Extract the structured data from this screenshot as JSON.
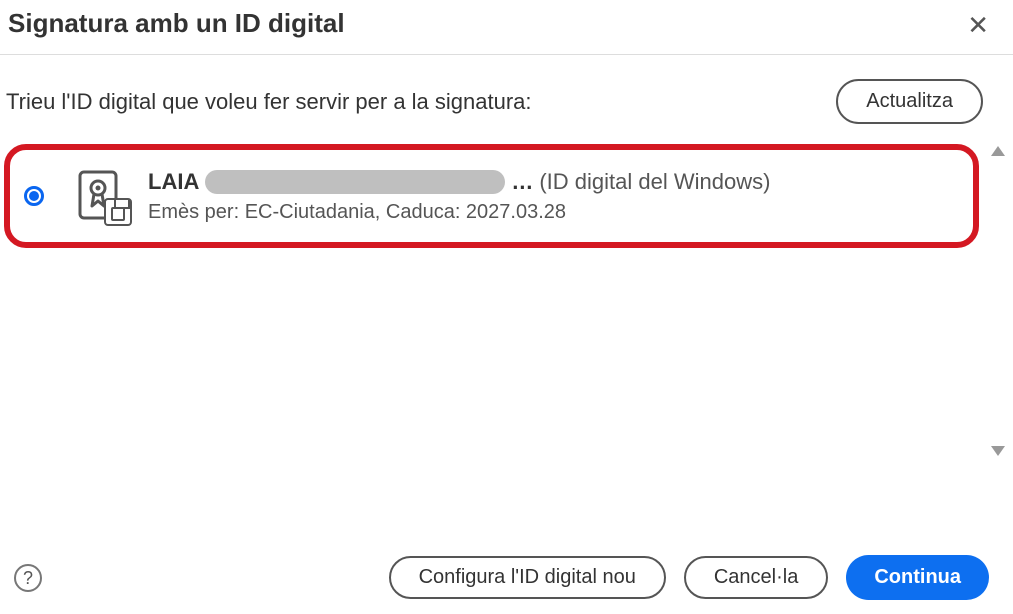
{
  "dialog": {
    "title": "Signatura amb un ID digital",
    "instruction": "Trieu l'ID digital que voleu fer servir per a la signatura:",
    "refresh_label": "Actualitza"
  },
  "certificate": {
    "name": "LAIA",
    "ellipsis": "…",
    "type_label": "(ID digital del Windows)",
    "issuer_expiry": "Emès per: EC-Ciutadania, Caduca: 2027.03.28"
  },
  "footer": {
    "help_label": "?",
    "configure_label": "Configura l'ID digital nou",
    "cancel_label": "Cancel·la",
    "continue_label": "Continua"
  }
}
